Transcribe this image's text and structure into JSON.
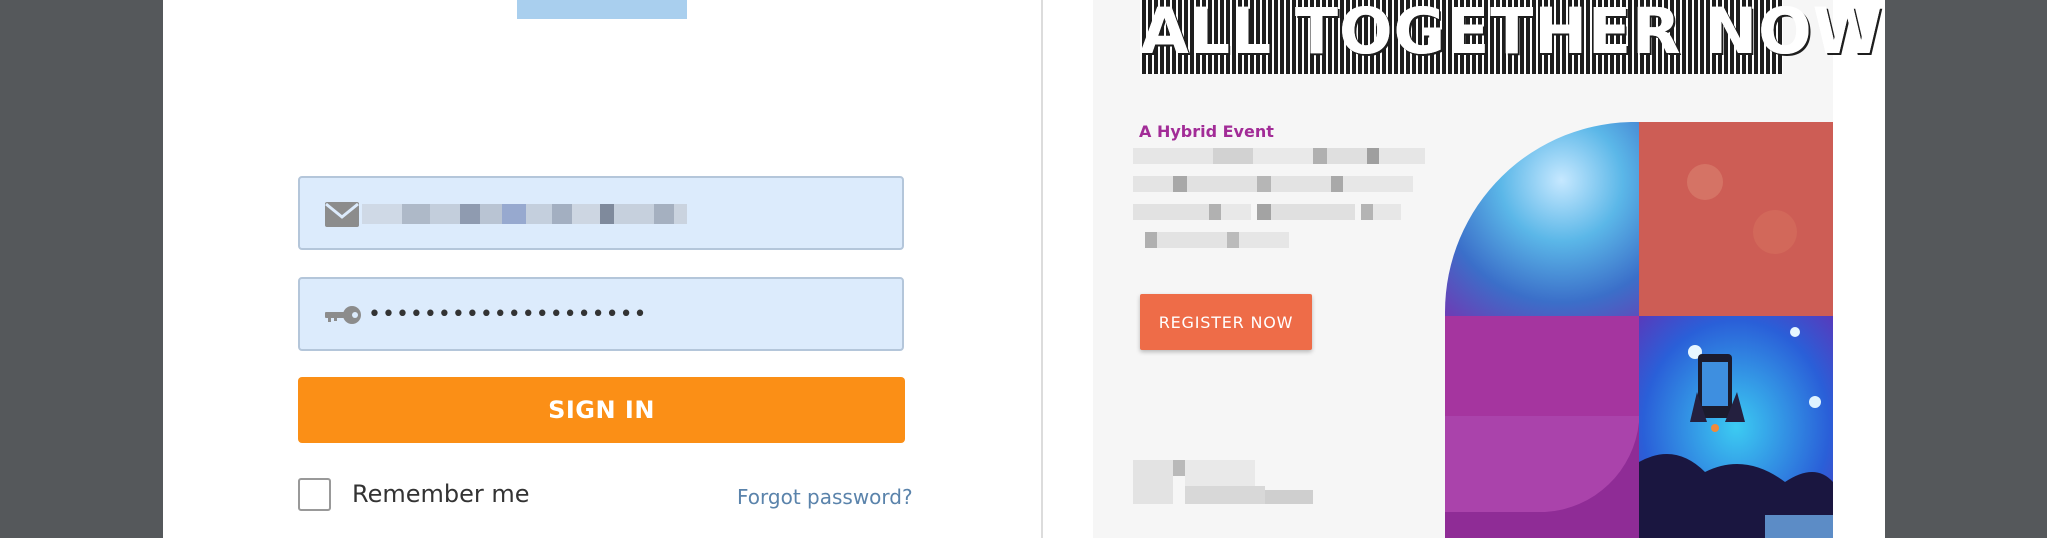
{
  "login": {
    "email_icon": "envelope-icon",
    "email_value": "",
    "password_icon": "key-icon",
    "password_value": "••••••••••••••••••••",
    "signin_label": "SIGN IN",
    "remember_label": "Remember me",
    "forgot_label": "Forgot password?"
  },
  "promo": {
    "headline": "ALL TOGETHER NOW",
    "subtitle": "A Hybrid Event",
    "register_label": "REGISTER NOW"
  },
  "colors": {
    "background": "#55585b",
    "signin": "#fb8f16",
    "field_bg": "#dcebfc",
    "link": "#5a83ab",
    "accent_purple": "#a22c97",
    "register": "#ee6c48"
  }
}
